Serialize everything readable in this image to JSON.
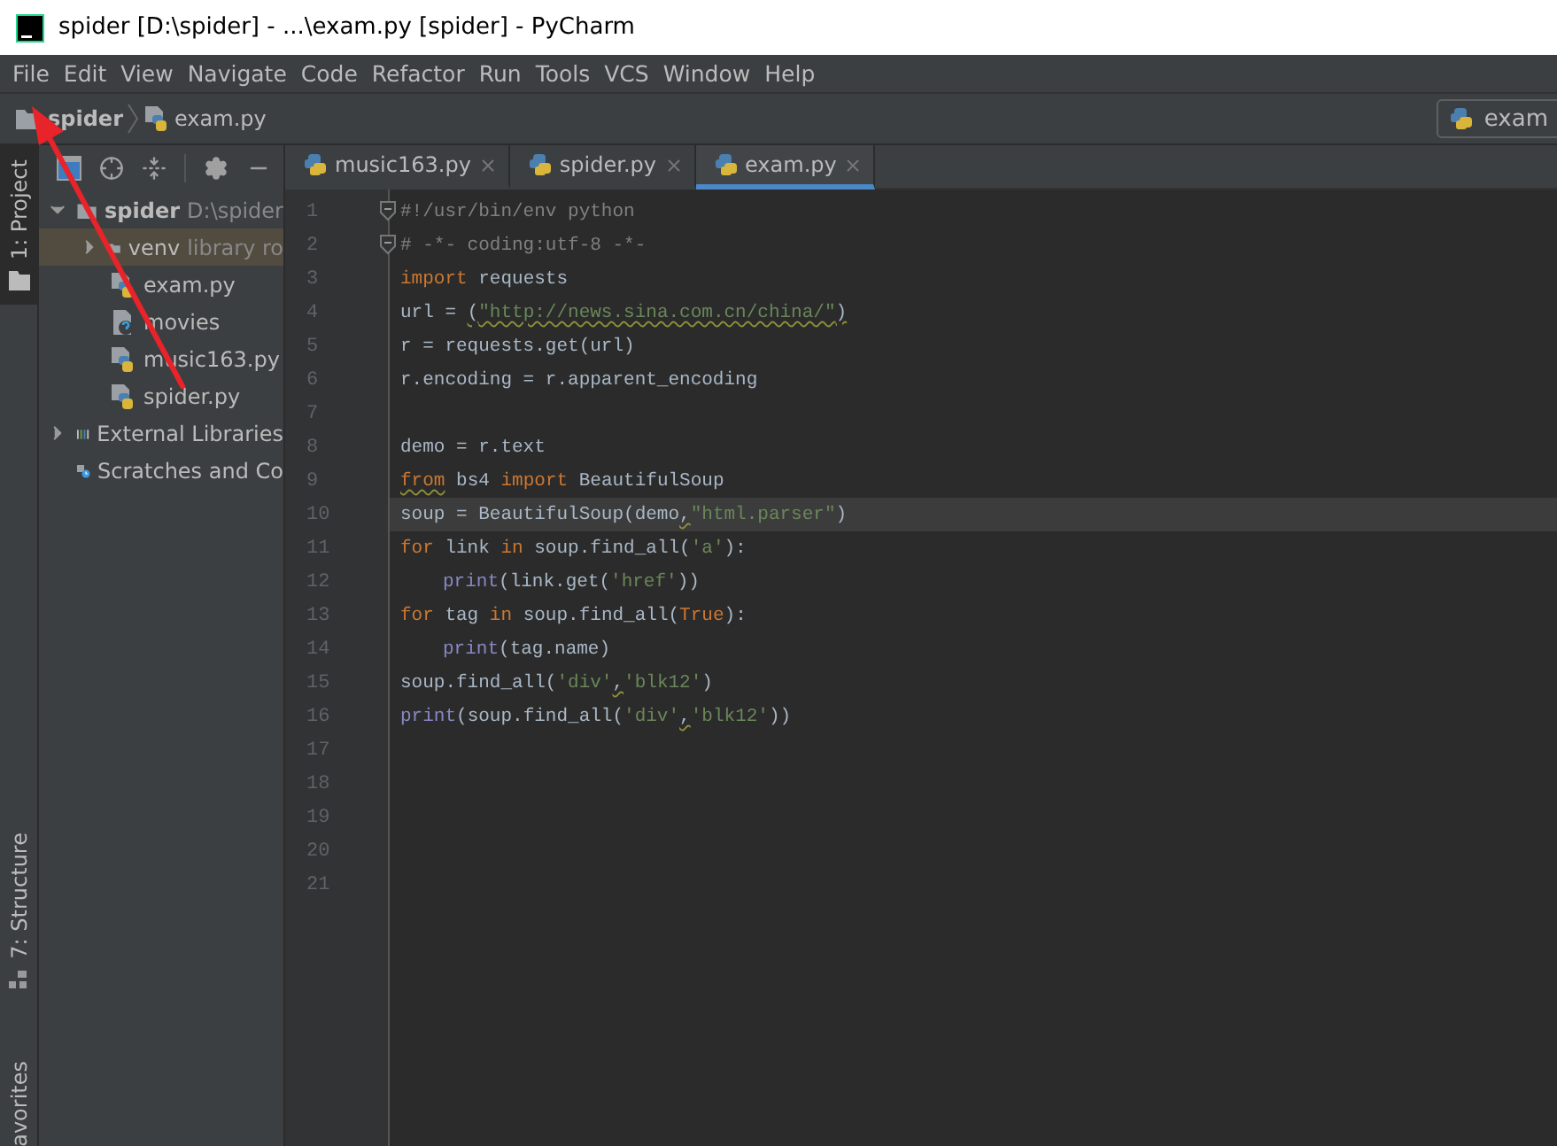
{
  "window": {
    "title": "spider [D:\\spider] - ...\\exam.py [spider] - PyCharm"
  },
  "menu": [
    "File",
    "Edit",
    "View",
    "Navigate",
    "Code",
    "Refactor",
    "Run",
    "Tools",
    "VCS",
    "Window",
    "Help"
  ],
  "breadcrumbs": [
    {
      "label": "spider",
      "kind": "folder"
    },
    {
      "label": "exam.py",
      "kind": "python"
    }
  ],
  "run_config": {
    "label": "exam"
  },
  "tool_windows": [
    {
      "label": "1: Project",
      "selected": true,
      "kind": "folder"
    },
    {
      "label": "7: Structure",
      "selected": false,
      "kind": "structure"
    }
  ],
  "bottom_tool_windows": [
    {
      "label": "avorites",
      "selected": false
    }
  ],
  "project_tree": [
    {
      "label": "spider",
      "detail": "D:\\spider",
      "kind": "folder",
      "expanded": true,
      "children": [
        {
          "label": "venv",
          "detail": "library ro",
          "kind": "folder",
          "expanded": false,
          "highlighted": true
        },
        {
          "label": "exam.py",
          "kind": "python"
        },
        {
          "label": "movies",
          "kind": "unknown"
        },
        {
          "label": "music163.py",
          "kind": "python"
        },
        {
          "label": "spider.py",
          "kind": "python"
        }
      ]
    },
    {
      "label": "External Libraries",
      "kind": "library",
      "expanded": false
    },
    {
      "label": "Scratches and Co",
      "kind": "scratch"
    }
  ],
  "editor_tabs": [
    {
      "label": "music163.py",
      "selected": false
    },
    {
      "label": "spider.py",
      "selected": false
    },
    {
      "label": "exam.py",
      "selected": true
    }
  ],
  "code_lines": [
    {
      "number": "1",
      "fold": true,
      "tokens": [
        {
          "text": "#!/usr/bin/env python",
          "kind": "comment"
        }
      ]
    },
    {
      "number": "2",
      "fold": true,
      "tokens": [
        {
          "text": "# -*- coding:utf-8 -*-",
          "kind": "comment"
        }
      ]
    },
    {
      "number": "3",
      "tokens": [
        {
          "text": "import",
          "kind": "keyword"
        },
        {
          "text": " requests",
          "kind": "plain"
        }
      ]
    },
    {
      "number": "4",
      "tokens": [
        {
          "text": "url = ",
          "kind": "plain"
        },
        {
          "text": "(",
          "kind": "plain",
          "warn": true
        },
        {
          "text": "\"http://news.sina.com.cn/china/\"",
          "kind": "string",
          "warn": true
        },
        {
          "text": ")",
          "kind": "plain",
          "warn": true
        }
      ]
    },
    {
      "number": "5",
      "tokens": [
        {
          "text": "r = requests.get(url)",
          "kind": "plain"
        }
      ]
    },
    {
      "number": "6",
      "tokens": [
        {
          "text": "r.encoding = r.apparent_encoding",
          "kind": "plain"
        }
      ]
    },
    {
      "number": "7"
    },
    {
      "number": "8",
      "tokens": [
        {
          "text": "demo = r.text",
          "kind": "plain"
        }
      ]
    },
    {
      "number": "9",
      "tokens": [
        {
          "text": "from",
          "kind": "keyword",
          "warn": true
        },
        {
          "text": " bs4 ",
          "kind": "plain"
        },
        {
          "text": "import",
          "kind": "keyword"
        },
        {
          "text": " BeautifulSoup",
          "kind": "plain"
        }
      ]
    },
    {
      "number": "10",
      "current": true,
      "tokens": [
        {
          "text": "soup = BeautifulSoup(demo",
          "kind": "plain"
        },
        {
          "text": ",",
          "kind": "plain",
          "warn": true
        },
        {
          "text": "\"html.parser\"",
          "kind": "string"
        },
        {
          "text": ")",
          "kind": "plain"
        }
      ]
    },
    {
      "number": "11",
      "tokens": [
        {
          "text": "for",
          "kind": "keyword"
        },
        {
          "text": " link ",
          "kind": "plain"
        },
        {
          "text": "in",
          "kind": "keyword"
        },
        {
          "text": " soup.find_all(",
          "kind": "plain"
        },
        {
          "text": "'a'",
          "kind": "string"
        },
        {
          "text": "):",
          "kind": "plain"
        }
      ]
    },
    {
      "number": "12",
      "indent": true,
      "tokens": [
        {
          "text": "print",
          "kind": "builtin"
        },
        {
          "text": "(link.get(",
          "kind": "plain"
        },
        {
          "text": "'href'",
          "kind": "string"
        },
        {
          "text": "))",
          "kind": "plain"
        }
      ]
    },
    {
      "number": "13",
      "tokens": [
        {
          "text": "for",
          "kind": "keyword"
        },
        {
          "text": " tag ",
          "kind": "plain"
        },
        {
          "text": "in",
          "kind": "keyword"
        },
        {
          "text": " soup.find_all(",
          "kind": "plain"
        },
        {
          "text": "True",
          "kind": "keyword"
        },
        {
          "text": "):",
          "kind": "plain"
        }
      ]
    },
    {
      "number": "14",
      "indent": true,
      "tokens": [
        {
          "text": "print",
          "kind": "builtin"
        },
        {
          "text": "(tag.name)",
          "kind": "plain"
        }
      ]
    },
    {
      "number": "15",
      "tokens": [
        {
          "text": "soup.find_all(",
          "kind": "plain"
        },
        {
          "text": "'div'",
          "kind": "string"
        },
        {
          "text": ",",
          "kind": "plain",
          "warn": true
        },
        {
          "text": "'blk12'",
          "kind": "string"
        },
        {
          "text": ")",
          "kind": "plain"
        }
      ]
    },
    {
      "number": "16",
      "tokens": [
        {
          "text": "print",
          "kind": "builtin"
        },
        {
          "text": "(soup.find_all(",
          "kind": "plain"
        },
        {
          "text": "'div'",
          "kind": "string"
        },
        {
          "text": ",",
          "kind": "plain",
          "warn": true
        },
        {
          "text": "'blk12'",
          "kind": "string"
        },
        {
          "text": "))",
          "kind": "plain"
        }
      ]
    },
    {
      "number": "17"
    },
    {
      "number": "18"
    },
    {
      "number": "19"
    },
    {
      "number": "20"
    },
    {
      "number": "21"
    }
  ]
}
